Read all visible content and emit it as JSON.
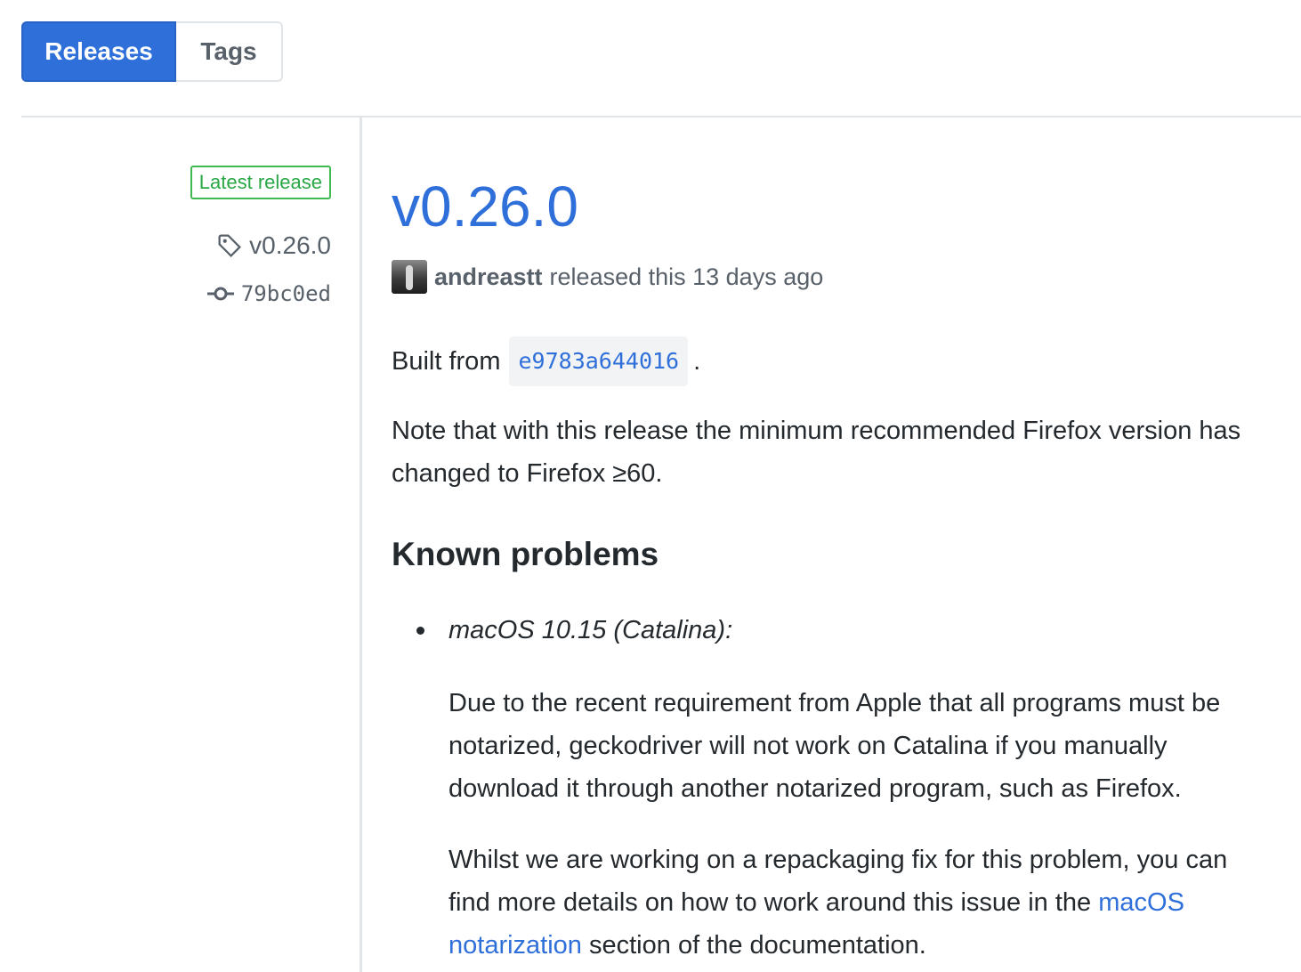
{
  "tabs": {
    "releases": "Releases",
    "tags": "Tags"
  },
  "meta": {
    "latest_badge": "Latest release",
    "tag": "v0.26.0",
    "commit": "79bc0ed"
  },
  "release": {
    "title": "v0.26.0",
    "author": "andreastt",
    "released_text": "released this 13 days ago",
    "built_from_label": "Built from",
    "built_from_commit": "e9783a644016",
    "built_from_suffix": ".",
    "note": "Note that with this release the minimum recommended Firefox version has changed to Firefox ≥60.",
    "known_problems_heading": "Known problems",
    "problem_item": "macOS 10.15 (Catalina):",
    "problem_para1": "Due to the recent requirement from Apple that all programs must be notarized, geckodriver will not work on Catalina if you manually download it through another notarized program, such as Firefox.",
    "problem_para2_prefix": "Whilst we are working on a repackaging fix for this problem, you can find more details on how to work around this issue in the",
    "problem_para2_link": "macOS notarization",
    "problem_para2_suffix": "section of the documentation."
  },
  "colors": {
    "accent": "#2f6fda",
    "badge_green": "#28a745",
    "muted": "#586069",
    "text": "#24292e"
  },
  "icons": {
    "tag": "tag-icon",
    "commit": "git-commit-icon"
  }
}
